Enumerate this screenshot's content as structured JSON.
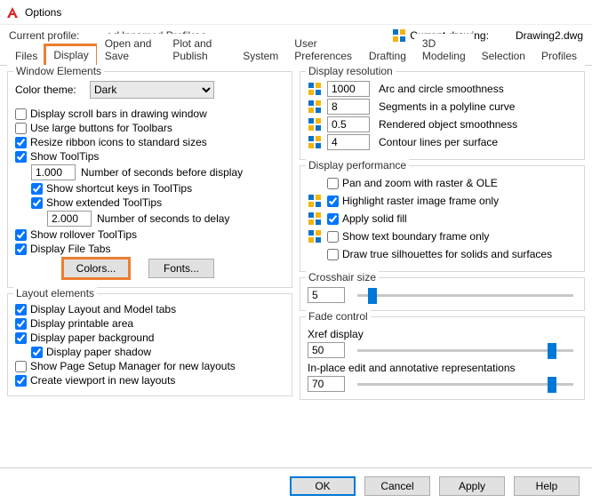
{
  "window": {
    "title": "Options"
  },
  "header": {
    "profile_label": "Current profile:",
    "profile_value": "<<Unnamed Profile>>",
    "drawing_label": "Current drawing:",
    "drawing_value": "Drawing2.dwg"
  },
  "tabs": {
    "files": "Files",
    "display": "Display",
    "open_save": "Open and Save",
    "plot_publish": "Plot and Publish",
    "system": "System",
    "user_prefs": "User Preferences",
    "drafting": "Drafting",
    "modeling": "3D Modeling",
    "selection": "Selection",
    "profiles": "Profiles"
  },
  "window_elements": {
    "legend": "Window Elements",
    "color_theme_label": "Color theme:",
    "color_theme_value": "Dark",
    "scrollbars": "Display scroll bars in drawing window",
    "large_buttons": "Use large buttons for Toolbars",
    "resize_ribbon": "Resize ribbon icons to standard sizes",
    "show_tooltips": "Show ToolTips",
    "seconds_before": "Number of seconds before display",
    "seconds_before_val": "1.000",
    "shortcut_keys": "Show shortcut keys in ToolTips",
    "extended_tooltips": "Show extended ToolTips",
    "seconds_delay": "Number of seconds to delay",
    "seconds_delay_val": "2.000",
    "rollover": "Show rollover ToolTips",
    "file_tabs": "Display File Tabs",
    "colors_btn": "Colors...",
    "fonts_btn": "Fonts..."
  },
  "layout_elements": {
    "legend": "Layout elements",
    "layout_model": "Display Layout and Model tabs",
    "printable": "Display printable area",
    "paper_bg": "Display paper background",
    "paper_shadow": "Display paper shadow",
    "page_setup": "Show Page Setup Manager for new layouts",
    "viewport": "Create viewport in new layouts"
  },
  "display_resolution": {
    "legend": "Display resolution",
    "arc_val": "1000",
    "arc_label": "Arc and circle smoothness",
    "seg_val": "8",
    "seg_label": "Segments in a polyline curve",
    "rend_val": "0.5",
    "rend_label": "Rendered object smoothness",
    "contour_val": "4",
    "contour_label": "Contour lines per surface"
  },
  "display_performance": {
    "legend": "Display performance",
    "pan_zoom": "Pan and zoom with raster & OLE",
    "highlight_raster": "Highlight raster image frame only",
    "solid_fill": "Apply solid fill",
    "text_boundary": "Show text boundary frame only",
    "true_silhouettes": "Draw true silhouettes for solids and surfaces"
  },
  "crosshair": {
    "legend": "Crosshair size",
    "value": "5",
    "thumb_pct": 5
  },
  "fade": {
    "legend": "Fade control",
    "xref_label": "Xref display",
    "xref_value": "50",
    "xref_thumb_pct": 88,
    "inplace_label": "In-place edit and annotative representations",
    "inplace_value": "70",
    "inplace_thumb_pct": 88
  },
  "buttons": {
    "ok": "OK",
    "cancel": "Cancel",
    "apply": "Apply",
    "help": "Help"
  }
}
